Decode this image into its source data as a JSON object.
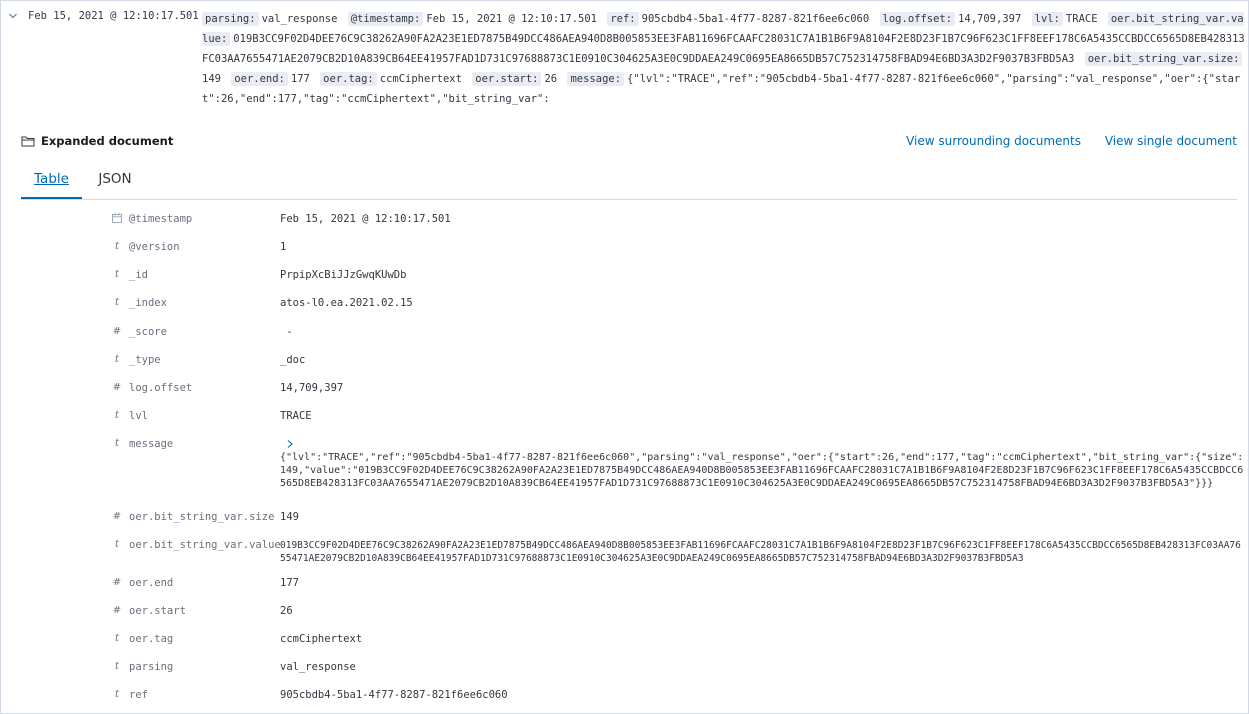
{
  "row": {
    "timestamp": "Feb 15, 2021 @ 12:10:17.501",
    "summary": [
      {
        "key": "parsing:",
        "value": "val_response"
      },
      {
        "key": "@timestamp:",
        "value": "Feb 15, 2021 @ 12:10:17.501"
      },
      {
        "key": "ref:",
        "value": "905cbdb4-5ba1-4f77-8287-821f6ee6c060"
      },
      {
        "key": "log.offset:",
        "value": "14,709,397"
      },
      {
        "key": "lvl:",
        "value": "TRACE"
      },
      {
        "key": "oer.bit_string_var.value:",
        "value": "019B3CC9F02D4DEE76C9C38262A90FA2A23E1ED7875B49DCC486AEA940D8B005853EE3FAB11696FCAAFC28031C7A1B1B6F9A8104F2E8D23F1B7C96F623C1FF8EEF178C6A5435CCBDCC6565D8EB428313FC03AA7655471AE2079CB2D10A839CB64EE41957FAD1D731C97688873C1E0910C304625A3E0C9DDAEA249C0695EA8665DB57C752314758FBAD94E6BD3A3D2F9037B3FBD5A3"
      },
      {
        "key": "oer.bit_string_var.size:",
        "value": "149"
      },
      {
        "key": "oer.end:",
        "value": "177"
      },
      {
        "key": "oer.tag:",
        "value": "ccmCiphertext"
      },
      {
        "key": "oer.start:",
        "value": "26"
      },
      {
        "key": "message:",
        "value": "{\"lvl\":\"TRACE\",\"ref\":\"905cbdb4-5ba1-4f77-8287-821f6ee6c060\",\"parsing\":\"val_response\",\"oer\":{\"start\":26,\"end\":177,\"tag\":\"ccmCiphertext\",\"bit_string_var\":"
      }
    ]
  },
  "expanded": {
    "title": "Expanded document",
    "view_surrounding": "View surrounding documents",
    "view_single": "View single document"
  },
  "tabs": {
    "table": "Table",
    "json": "JSON"
  },
  "fields": [
    {
      "type": "date",
      "name": "@timestamp",
      "value": "Feb 15, 2021 @ 12:10:17.501"
    },
    {
      "type": "t",
      "name": "@version",
      "value": "1"
    },
    {
      "type": "t",
      "name": "_id",
      "value": "PrpipXcBiJJzGwqKUwDb"
    },
    {
      "type": "t",
      "name": "_index",
      "value": "atos-l0.ea.2021.02.15"
    },
    {
      "type": "#",
      "name": "_score",
      "value": " -"
    },
    {
      "type": "t",
      "name": "_type",
      "value": "_doc"
    },
    {
      "type": "#",
      "name": "log.offset",
      "value": "14,709,397"
    },
    {
      "type": "t",
      "name": "lvl",
      "value": "TRACE"
    },
    {
      "type": "t",
      "name": "message",
      "value": "{\"lvl\":\"TRACE\",\"ref\":\"905cbdb4-5ba1-4f77-8287-821f6ee6c060\",\"parsing\":\"val_response\",\"oer\":{\"start\":26,\"end\":177,\"tag\":\"ccmCiphertext\",\"bit_string_var\":{\"size\":149,\"value\":\"019B3CC9F02D4DEE76C9C38262A90FA2A23E1ED7875B49DCC486AEA940D8B005853EE3FAB11696FCAAFC28031C7A1B1B6F9A8104F2E8D23F1B7C96F623C1FF8EEF178C6A5435CCBDCC6565D8EB428313FC03AA7655471AE2079CB2D10A839CB64EE41957FAD1D731C97688873C1E0910C304625A3E0C9DDAEA249C0695EA8665DB57C752314758FBAD94E6BD3A3D2F9037B3FBD5A3\"}}}"
    },
    {
      "type": "#",
      "name": "oer.bit_string_var.size",
      "value": "149"
    },
    {
      "type": "t",
      "name": "oer.bit_string_var.value",
      "value": "019B3CC9F02D4DEE76C9C38262A90FA2A23E1ED7875B49DCC486AEA940D8B005853EE3FAB11696FCAAFC28031C7A1B1B6F9A8104F2E8D23F1B7C96F623C1FF8EEF178C6A5435CCBDCC6565D8EB428313FC03AA7655471AE2079CB2D10A839CB64EE41957FAD1D731C97688873C1E0910C304625A3E0C9DDAEA249C0695EA8665DB57C752314758FBAD94E6BD3A3D2F9037B3FBD5A3"
    },
    {
      "type": "#",
      "name": "oer.end",
      "value": "177"
    },
    {
      "type": "#",
      "name": "oer.start",
      "value": "26"
    },
    {
      "type": "t",
      "name": "oer.tag",
      "value": "ccmCiphertext"
    },
    {
      "type": "t",
      "name": "parsing",
      "value": "val_response"
    },
    {
      "type": "t",
      "name": "ref",
      "value": "905cbdb4-5ba1-4f77-8287-821f6ee6c060"
    }
  ],
  "colors": {
    "link": "#006bb4",
    "text": "#343741",
    "subdued": "#69707d",
    "badge_bg": "#e9edf3",
    "border": "#d3dae6"
  },
  "icons": {
    "row_toggle": "chevron-down-icon",
    "expanded_header": "folder-icon",
    "message_expand": "chevron-right-icon",
    "date_type": "calendar-icon"
  }
}
